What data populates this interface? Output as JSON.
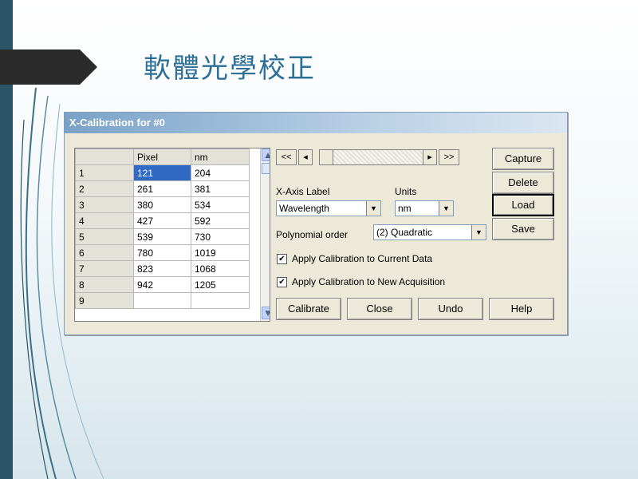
{
  "slide": {
    "title": "軟體光學校正"
  },
  "window": {
    "title": "X-Calibration for #0"
  },
  "grid": {
    "headers": [
      "Pixel",
      "nm"
    ],
    "rows": [
      {
        "index": "1",
        "pixel": "121",
        "nm": "204"
      },
      {
        "index": "2",
        "pixel": "261",
        "nm": "381"
      },
      {
        "index": "3",
        "pixel": "380",
        "nm": "534"
      },
      {
        "index": "4",
        "pixel": "427",
        "nm": "592"
      },
      {
        "index": "5",
        "pixel": "539",
        "nm": "730"
      },
      {
        "index": "6",
        "pixel": "780",
        "nm": "1019"
      },
      {
        "index": "7",
        "pixel": "823",
        "nm": "1068"
      },
      {
        "index": "8",
        "pixel": "942",
        "nm": "1205"
      },
      {
        "index": "9",
        "pixel": "",
        "nm": ""
      }
    ]
  },
  "slider": {
    "first": "<<",
    "prev": "◂",
    "next": "▸",
    "last": ">>"
  },
  "xaxis": {
    "label": "X-Axis Label",
    "value": "Wavelength"
  },
  "units": {
    "label": "Units",
    "value": "nm"
  },
  "poly": {
    "label": "Polynomial order",
    "value": "(2) Quadratic"
  },
  "checks": {
    "apply_current": "Apply Calibration to Current Data",
    "apply_new": "Apply Calibration to New Acquisition"
  },
  "side_buttons": {
    "capture": "Capture",
    "delete": "Delete",
    "load": "Load",
    "save": "Save"
  },
  "bottom_buttons": {
    "calibrate": "Calibrate",
    "close": "Close",
    "undo": "Undo",
    "help": "Help"
  }
}
